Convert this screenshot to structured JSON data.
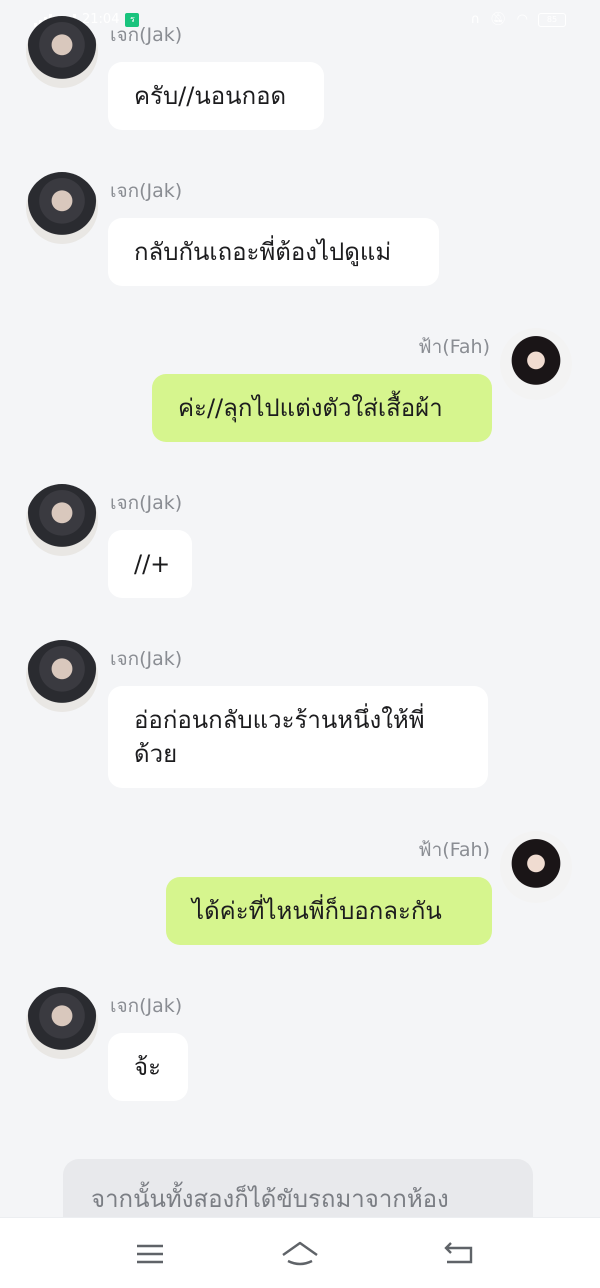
{
  "status_bar": {
    "time": "21:04",
    "app_badge": "ร",
    "battery": "85"
  },
  "messages": [
    {
      "side": "left",
      "name": "เจก(Jak)",
      "text": "ครับ//นอนกอด"
    },
    {
      "side": "left",
      "name": "เจก(Jak)",
      "text": "กลับกันเถอะพี่ต้องไปดูแม่"
    },
    {
      "side": "right",
      "name": "ฟ้า(Fah)",
      "text": "ค่ะ//ลุกไปแต่งตัวใส่เสื้อผ้า"
    },
    {
      "side": "left",
      "name": "เจก(Jak)",
      "text": "//+"
    },
    {
      "side": "left",
      "name": "เจก(Jak)",
      "text": "อ่อก่อนกลับแวะร้านหนึ่งให้พี่ด้วย"
    },
    {
      "side": "right",
      "name": "ฟ้า(Fah)",
      "text": "ได้ค่ะที่ไหนพี่ก็บอกละกัน"
    },
    {
      "side": "left",
      "name": "เจก(Jak)",
      "text": "จ้ะ"
    }
  ],
  "narration": "จากนั้นทั้งสองก็ได้ขับรถมาจากห้อง",
  "nav": {
    "menu_icon": "menu-icon",
    "home_icon": "home-icon",
    "back_icon": "back-icon"
  }
}
